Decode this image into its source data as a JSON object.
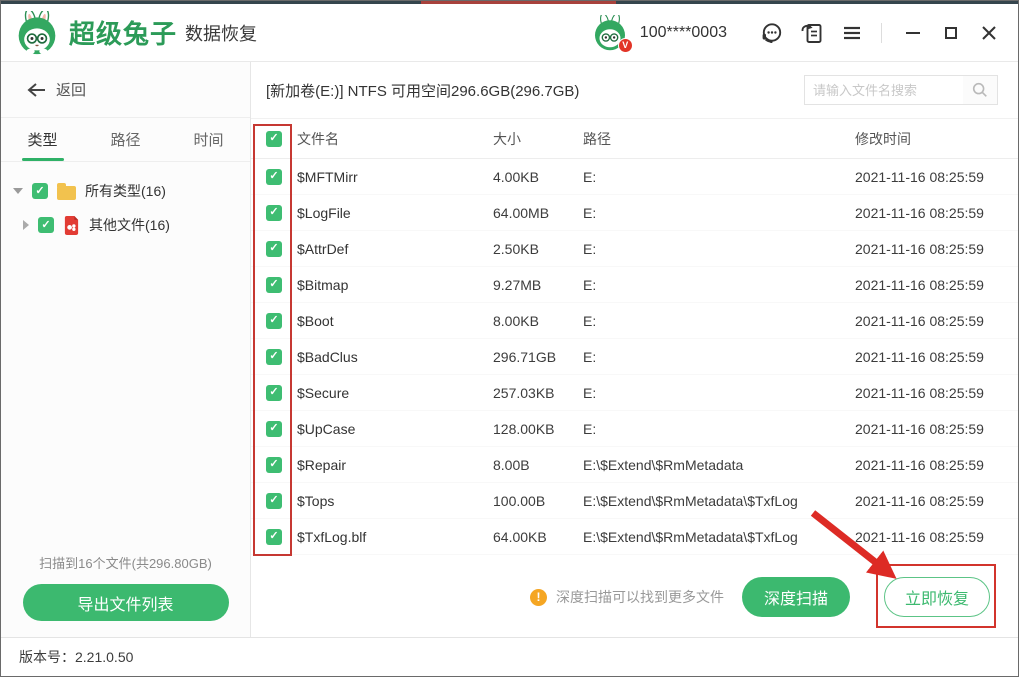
{
  "header": {
    "brand_name": "超级兔子",
    "product_name": "数据恢复",
    "account": "100****0003",
    "icons": [
      "rabbit-logo",
      "avatar",
      "vip-badge",
      "headset-icon",
      "feedback-icon",
      "menu-icon",
      "minimize-icon",
      "maximize-icon",
      "close-icon"
    ],
    "vip_badge": "V"
  },
  "sidebar": {
    "back_label": "返回",
    "tabs": [
      {
        "label": "类型",
        "active": true
      },
      {
        "label": "路径",
        "active": false
      },
      {
        "label": "时间",
        "active": false
      }
    ],
    "tree": [
      {
        "label": "所有类型(16)",
        "checked": true,
        "icon": "folder-icon"
      },
      {
        "label": "其他文件(16)",
        "checked": true,
        "icon": "media-file-icon"
      }
    ],
    "scan_summary": "扫描到16个文件(共296.80GB)",
    "export_button": "导出文件列表"
  },
  "main": {
    "volume_info": "[新加卷(E:)] NTFS 可用空间296.6GB(296.7GB)",
    "search_placeholder": "请输入文件名搜索",
    "table": {
      "columns": [
        "文件名",
        "大小",
        "路径",
        "修改时间"
      ],
      "select_all_checked": true,
      "rows": [
        {
          "name": "$MFTMirr",
          "size": "4.00KB",
          "path": "E:",
          "time": "2021-11-16 08:25:59",
          "checked": true
        },
        {
          "name": "$LogFile",
          "size": "64.00MB",
          "path": "E:",
          "time": "2021-11-16 08:25:59",
          "checked": true
        },
        {
          "name": "$AttrDef",
          "size": "2.50KB",
          "path": "E:",
          "time": "2021-11-16 08:25:59",
          "checked": true
        },
        {
          "name": "$Bitmap",
          "size": "9.27MB",
          "path": "E:",
          "time": "2021-11-16 08:25:59",
          "checked": true
        },
        {
          "name": "$Boot",
          "size": "8.00KB",
          "path": "E:",
          "time": "2021-11-16 08:25:59",
          "checked": true
        },
        {
          "name": "$BadClus",
          "size": "296.71GB",
          "path": "E:",
          "time": "2021-11-16 08:25:59",
          "checked": true
        },
        {
          "name": "$Secure",
          "size": "257.03KB",
          "path": "E:",
          "time": "2021-11-16 08:25:59",
          "checked": true
        },
        {
          "name": "$UpCase",
          "size": "128.00KB",
          "path": "E:",
          "time": "2021-11-16 08:25:59",
          "checked": true
        },
        {
          "name": "$Repair",
          "size": "8.00B",
          "path": "E:\\$Extend\\$RmMetadata",
          "time": "2021-11-16 08:25:59",
          "checked": true
        },
        {
          "name": "$Tops",
          "size": "100.00B",
          "path": "E:\\$Extend\\$RmMetadata\\$TxfLog",
          "time": "2021-11-16 08:25:59",
          "checked": true
        },
        {
          "name": "$TxfLog.blf",
          "size": "64.00KB",
          "path": "E:\\$Extend\\$RmMetadata\\$TxfLog",
          "time": "2021-11-16 08:25:59",
          "checked": true
        }
      ]
    },
    "action_bar": {
      "hint": "深度扫描可以找到更多文件",
      "deep_scan_button": "深度扫描",
      "recover_button": "立即恢复"
    }
  },
  "status_bar": {
    "version_text": "版本号：2.21.0.50"
  },
  "colors": {
    "brand_green": "#2c9b58",
    "button_green": "#3cb96f",
    "checkbox_green": "#3ebd72",
    "annotation_red": "#d2342c",
    "warning_orange": "#f5a623",
    "folder_yellow": "#f2c24e"
  }
}
